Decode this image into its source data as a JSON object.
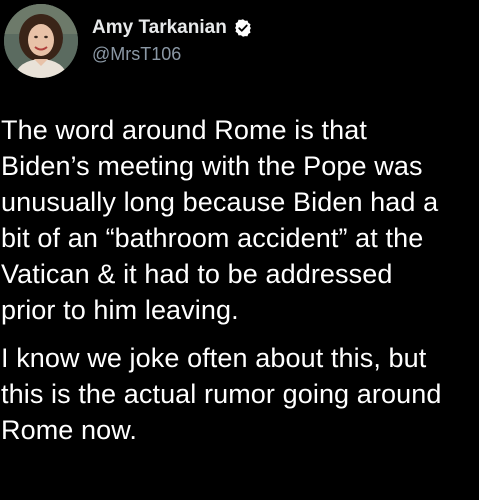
{
  "author": {
    "display_name": "Amy Tarkanian",
    "handle": "@MrsT106",
    "verified_icon": "verified-badge-icon",
    "avatar_icon": "profile-photo"
  },
  "tweet": {
    "paragraphs": [
      {
        "lines": [
          "The word around Rome is that",
          "Biden’s meeting with the Pope was",
          "unusually long because Biden had a",
          "bit of an “bathroom accident” at the",
          "Vatican & it had to be addressed",
          "prior to him leaving."
        ]
      },
      {
        "lines": [
          "I know we joke often about this, but",
          "this is the actual rumor going around",
          "Rome now."
        ]
      }
    ]
  },
  "colors": {
    "background": "#000000",
    "text": "#ffffff",
    "secondary_text": "#8b98a5",
    "verified_badge": "#ffffff"
  }
}
